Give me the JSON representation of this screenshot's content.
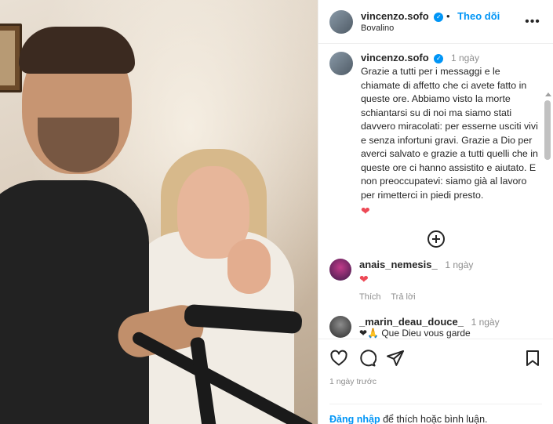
{
  "post": {
    "username": "vincenzo.sofo",
    "follow_label": "Theo dõi",
    "location": "Bovalino",
    "more_label": "•••"
  },
  "caption": {
    "username": "vincenzo.sofo",
    "time": "1 ngày",
    "text": "Grazie a tutti per i messaggi e le chiamate di affetto che ci avete fatto in queste ore. Abbiamo visto la morte schiantarsi su di noi ma siamo stati davvero miracolati: per esserne usciti vivi e senza infortuni gravi. Grazie a Dio per averci salvato e grazie a tutti quelli che in queste ore ci hanno assistito e aiutato. E non preoccupatevi: siamo già al lavoro per rimetterci in piedi presto.",
    "emoji": "❤"
  },
  "comments": [
    {
      "username": "anais_nemesis_",
      "time": "1 ngày",
      "text": "❤",
      "like_label": "Thích",
      "reply_label": "Trả lời"
    },
    {
      "username": "_marin_deau_douce_",
      "time": "1 ngày",
      "text": "❤🙏 Que Dieu vous garde"
    }
  ],
  "actions": {
    "date": "1 ngày trước"
  },
  "login": {
    "link": "Đăng nhập",
    "rest": " để thích hoặc bình luận."
  },
  "icons": {
    "verified": "verified-badge-icon",
    "like": "heart-outline-icon",
    "comment": "comment-bubble-icon",
    "share": "paper-plane-icon",
    "save": "bookmark-icon",
    "add": "plus-circle-icon"
  },
  "colors": {
    "accent": "#0095f6",
    "heart": "#ed4956",
    "muted": "#8e8e8e"
  }
}
